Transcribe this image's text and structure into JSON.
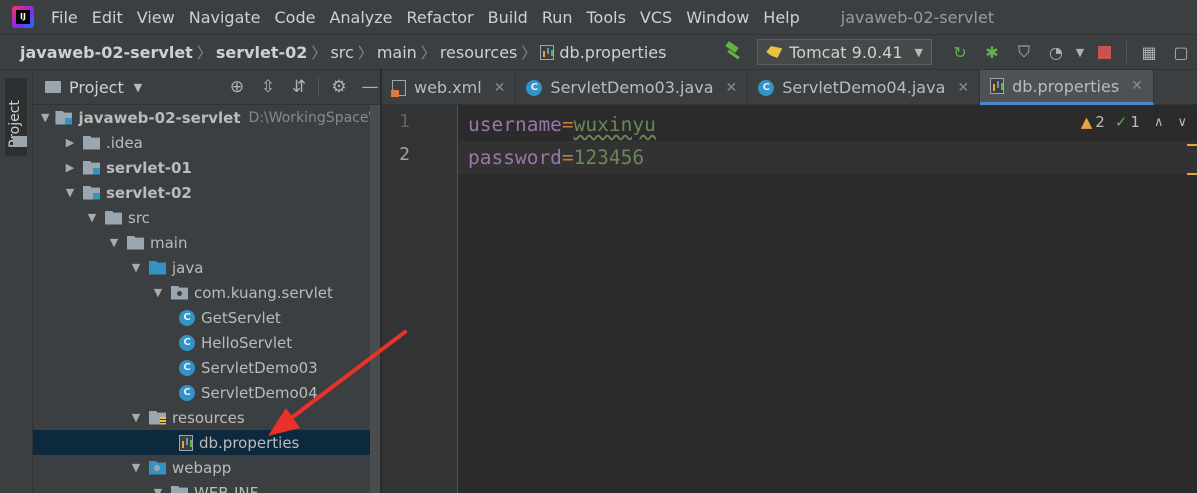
{
  "menu": {
    "items": [
      "File",
      "Edit",
      "View",
      "Navigate",
      "Code",
      "Analyze",
      "Refactor",
      "Build",
      "Run",
      "Tools",
      "VCS",
      "Window",
      "Help"
    ],
    "window_title": "javaweb-02-servlet"
  },
  "breadcrumb": {
    "items": [
      "javaweb-02-servlet",
      "servlet-02",
      "src",
      "main",
      "resources",
      "db.properties"
    ]
  },
  "run_config": {
    "label": "Tomcat 9.0.41"
  },
  "side_strip": {
    "label": "Project"
  },
  "project_panel": {
    "title": "Project",
    "tree": [
      {
        "label": "javaweb-02-servlet",
        "hint": "D:\\WorkingSpace\\Ic"
      },
      {
        "label": ".idea"
      },
      {
        "label": "servlet-01"
      },
      {
        "label": "servlet-02"
      },
      {
        "label": "src"
      },
      {
        "label": "main"
      },
      {
        "label": "java"
      },
      {
        "label": "com.kuang.servlet"
      },
      {
        "label": "GetServlet"
      },
      {
        "label": "HelloServlet"
      },
      {
        "label": "ServletDemo03"
      },
      {
        "label": "ServletDemo04"
      },
      {
        "label": "resources"
      },
      {
        "label": "db.properties"
      },
      {
        "label": "webapp"
      },
      {
        "label": "WEB-INF"
      }
    ]
  },
  "editor": {
    "tabs": [
      {
        "label": "web.xml"
      },
      {
        "label": "ServletDemo03.java"
      },
      {
        "label": "ServletDemo04.java"
      },
      {
        "label": "db.properties"
      }
    ],
    "lines": [
      {
        "num": "1",
        "key": "username",
        "eq": "=",
        "value": "wuxinyu"
      },
      {
        "num": "2",
        "key": "password",
        "eq": "=",
        "value": "123456"
      }
    ],
    "warnings": "2",
    "weak_warnings": "1"
  },
  "colors": {
    "background": "#2b2b2b",
    "panel": "#3c3f41",
    "accent": "#4a88c7",
    "annotation_arrow": "#e8322a"
  }
}
